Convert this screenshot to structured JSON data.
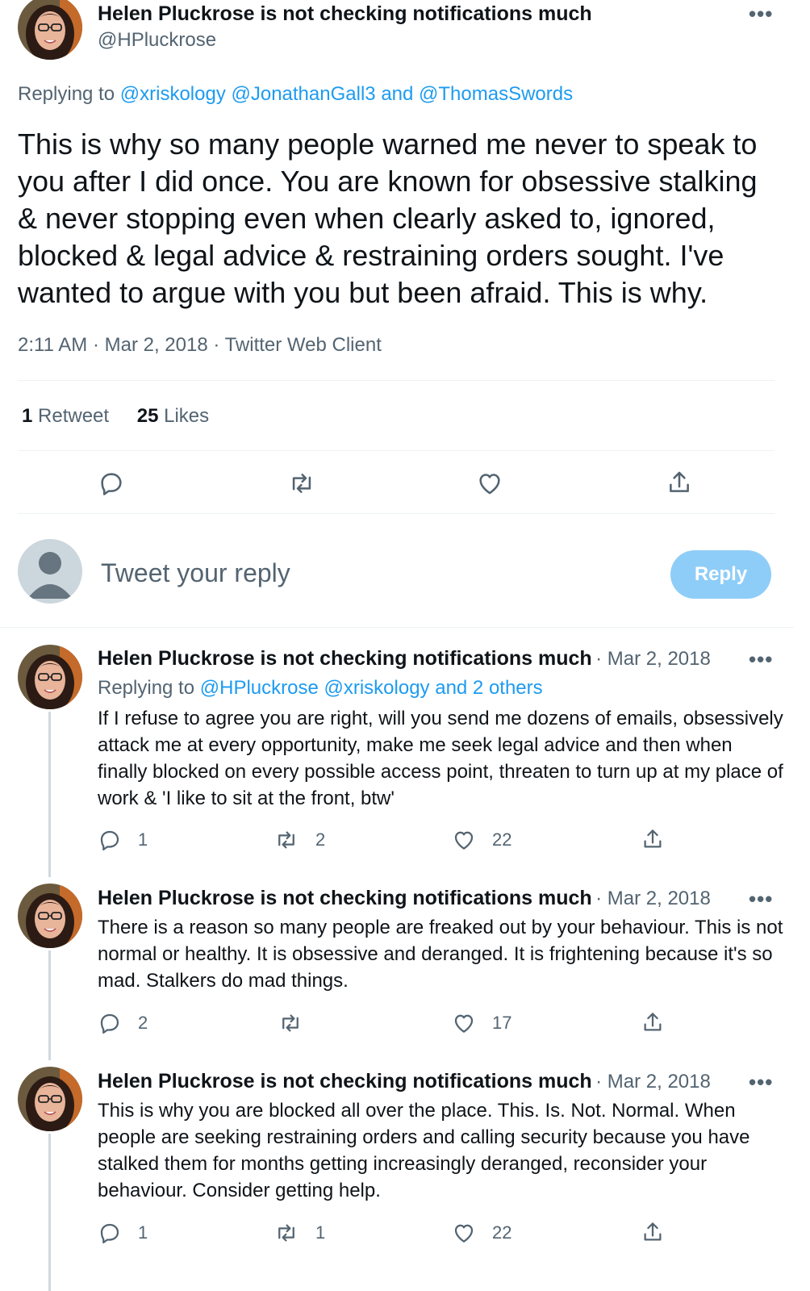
{
  "main_tweet": {
    "display_name": "Helen Pluckrose is not checking notifications much",
    "handle": "@HPluckrose",
    "replying_prefix": "Replying to",
    "replying_to": [
      "@xriskology",
      "@JonathanGall3",
      "and",
      "@ThomasSwords"
    ],
    "text": "This is why so many people warned me never to speak to you after I did once. You are known for obsessive stalking & never stopping even when clearly asked to, ignored, blocked & legal advice & restraining orders sought. I've wanted to argue with you but been afraid. This is why.",
    "timestamp": "2:11 AM · Mar 2, 2018 · Twitter Web Client",
    "retweets_count": "1",
    "retweets_label": "Retweet",
    "likes_count": "25",
    "likes_label": "Likes",
    "more_label": "•••"
  },
  "compose": {
    "placeholder": "Tweet your reply",
    "button_label": "Reply"
  },
  "replies": [
    {
      "display_name": "Helen Pluckrose is not checking notifications much",
      "date": "· Mar 2, 2018",
      "replying_prefix": "Replying to",
      "replying_to": "@HPluckrose @xriskology and 2 others",
      "text": "If I refuse to agree you are right, will you send me dozens of emails, obsessively attack me at every opportunity, make me seek legal advice and then when finally blocked on every possible access point, threaten to turn up at my place of work & 'I like to sit at the front, btw'",
      "reply_count": "1",
      "retweet_count": "2",
      "like_count": "22",
      "more_label": "•••"
    },
    {
      "display_name": "Helen Pluckrose is not checking notifications much",
      "date": "· Mar 2, 2018",
      "text": "There is a reason so many people are freaked out by your behaviour. This is not normal or healthy. It is obsessive and deranged. It is frightening because it's so mad. Stalkers do mad things.",
      "reply_count": "2",
      "retweet_count": "",
      "like_count": "17",
      "more_label": "•••"
    },
    {
      "display_name": "Helen Pluckrose is not checking notifications much",
      "date": "· Mar 2, 2018",
      "text": "This is why you are blocked all over the place. This. Is. Not. Normal. When people are seeking restraining orders and calling security because you have stalked them for months getting increasingly deranged, reconsider your behaviour. Consider getting help.",
      "reply_count": "1",
      "retweet_count": "1",
      "like_count": "22",
      "more_label": "•••"
    }
  ],
  "icons": {
    "reply": "reply-icon",
    "retweet": "retweet-icon",
    "like": "heart-icon",
    "share": "share-icon",
    "more": "more-icon"
  },
  "colors": {
    "link": "#1d9bf0",
    "muted": "#536471",
    "reply_button": "#8ecdf8"
  }
}
